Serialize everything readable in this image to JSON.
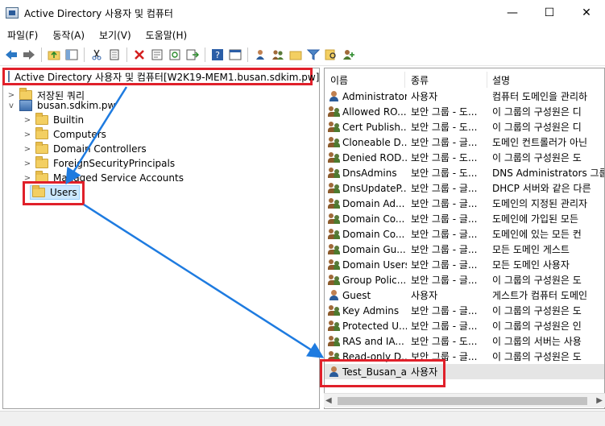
{
  "window": {
    "title": "Active Directory 사용자 및 컴퓨터",
    "minimize": "—",
    "maximize": "☐",
    "close": "✕"
  },
  "menu": [
    "파일(F)",
    "동작(A)",
    "보기(V)",
    "도움말(H)"
  ],
  "toolbar_icons": [
    "back-icon",
    "forward-icon",
    "up-folder-icon",
    "show-tree-icon",
    "cut-icon",
    "copy-icon",
    "delete-icon",
    "properties-icon",
    "refresh-icon",
    "export-icon",
    "help-icon",
    "console-icon",
    "new-user-icon",
    "new-group-icon",
    "new-ou-icon",
    "filter-icon",
    "find-icon",
    "add-member-icon"
  ],
  "tree": {
    "root": "Active Directory 사용자 및 컴퓨터[W2K19-MEM1.busan.sdkim.pw]",
    "saved_queries": "저장된 쿼리",
    "domain": "busan.sdkim.pw",
    "children": [
      "Builtin",
      "Computers",
      "Domain Controllers",
      "ForeignSecurityPrincipals",
      "Managed Service Accounts",
      "Users"
    ]
  },
  "list": {
    "columns": [
      "이름",
      "종류",
      "설명"
    ],
    "rows": [
      {
        "icon": "user",
        "name": "Administrator",
        "type": "사용자",
        "desc": "컴퓨터 도메인을 관리하"
      },
      {
        "icon": "group",
        "name": "Allowed RO...",
        "type": "보안 그룹 - 도...",
        "desc": "이 그룹의 구성원은 디"
      },
      {
        "icon": "group",
        "name": "Cert Publish...",
        "type": "보안 그룹 - 도...",
        "desc": "이 그룹의 구성원은 디"
      },
      {
        "icon": "group",
        "name": "Cloneable D...",
        "type": "보안 그룹 - 글...",
        "desc": "도메인 컨트롤러가 아닌"
      },
      {
        "icon": "group",
        "name": "Denied ROD...",
        "type": "보안 그룹 - 도...",
        "desc": "이 그룹의 구성원은 도"
      },
      {
        "icon": "group",
        "name": "DnsAdmins",
        "type": "보안 그룹 - 도...",
        "desc": "DNS Administrators 그룹"
      },
      {
        "icon": "group",
        "name": "DnsUpdateP...",
        "type": "보안 그룹 - 글...",
        "desc": "DHCP 서버와 같은 다른"
      },
      {
        "icon": "group",
        "name": "Domain Ad...",
        "type": "보안 그룹 - 글...",
        "desc": "도메인의 지정된 관리자"
      },
      {
        "icon": "group",
        "name": "Domain Co...",
        "type": "보안 그룹 - 글...",
        "desc": "도메인에 가입된 모든"
      },
      {
        "icon": "group",
        "name": "Domain Co...",
        "type": "보안 그룹 - 글...",
        "desc": "도메인에 있는 모든 컨"
      },
      {
        "icon": "group",
        "name": "Domain Gu...",
        "type": "보안 그룹 - 글...",
        "desc": "모든 도메인 게스트"
      },
      {
        "icon": "group",
        "name": "Domain Users",
        "type": "보안 그룹 - 글...",
        "desc": "모든 도메인 사용자"
      },
      {
        "icon": "group",
        "name": "Group Polic...",
        "type": "보안 그룹 - 글...",
        "desc": "이 그룹의 구성원은 도"
      },
      {
        "icon": "user",
        "name": "Guest",
        "type": "사용자",
        "desc": "게스트가 컴퓨터 도메인"
      },
      {
        "icon": "group",
        "name": "Key Admins",
        "type": "보안 그룹 - 글...",
        "desc": "이 그룹의 구성원은 도"
      },
      {
        "icon": "group",
        "name": "Protected U...",
        "type": "보안 그룹 - 글...",
        "desc": "이 그룹의 구성원은 인"
      },
      {
        "icon": "group",
        "name": "RAS and IA...",
        "type": "보안 그룹 - 도...",
        "desc": "이 그룹의 서버는 사용"
      },
      {
        "icon": "group",
        "name": "Read-only D...",
        "type": "보안 그룹 - 글...",
        "desc": "이 그룹의 구성원은 도"
      },
      {
        "icon": "user",
        "name": "Test_Busan_aa",
        "type": "사용자",
        "desc": ""
      }
    ]
  },
  "scrollbar": {
    "left_arrow": "◀",
    "right_arrow": "▶"
  },
  "colors": {
    "highlight_border": "#e0202a",
    "arrow": "#1e7be0",
    "selection": "#cce8ff"
  }
}
